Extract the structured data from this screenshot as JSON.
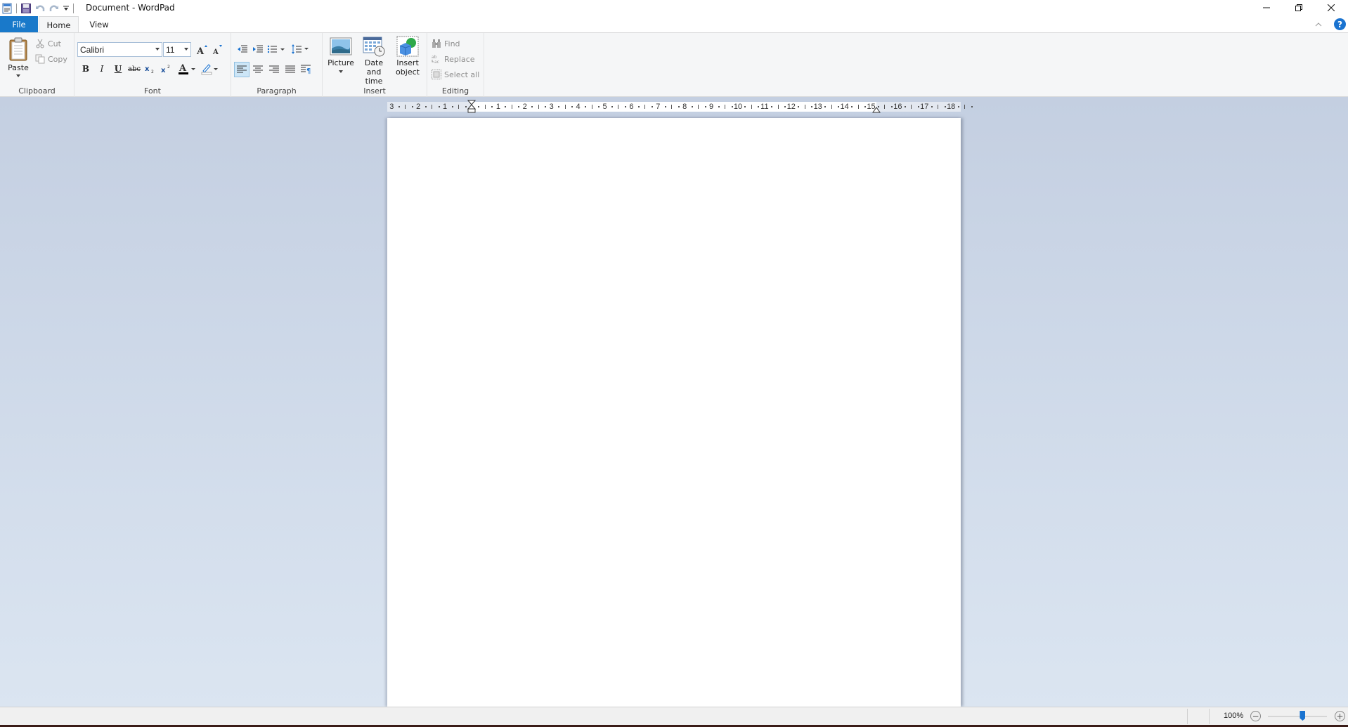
{
  "window": {
    "title": "Document - WordPad",
    "controls": {
      "minimize": "minimize-icon",
      "restore": "restore-icon",
      "close": "close-icon"
    }
  },
  "quick_access": [
    {
      "name": "app-icon"
    },
    {
      "name": "save-icon"
    },
    {
      "name": "undo-icon"
    },
    {
      "name": "redo-icon"
    },
    {
      "name": "customize-qat-icon"
    }
  ],
  "tabs": [
    {
      "label": "File",
      "active": false
    },
    {
      "label": "Home",
      "active": true
    },
    {
      "label": "View",
      "active": false
    }
  ],
  "help_label": "?",
  "ribbon": {
    "clipboard": {
      "label": "Clipboard",
      "paste": "Paste",
      "cut": "Cut",
      "copy": "Copy"
    },
    "font": {
      "label": "Font",
      "family": "Calibri",
      "size": "11",
      "bold": "B",
      "italic": "I",
      "underline": "U",
      "strikethrough": "abc",
      "font_color": "#000000",
      "highlight_color": "#ffffff"
    },
    "paragraph": {
      "label": "Paragraph",
      "alignment": "left"
    },
    "insert": {
      "label": "Insert",
      "picture": "Picture",
      "datetime": "Date and time",
      "datetime_line1": "Date and",
      "datetime_line2": "time",
      "object_line1": "Insert",
      "object_line2": "object"
    },
    "editing": {
      "label": "Editing",
      "find": "Find",
      "replace": "Replace",
      "select_all": "Select all"
    }
  },
  "ruler": {
    "left_labels": [
      "3",
      "2",
      "1"
    ],
    "right_labels": [
      "1",
      "2",
      "3",
      "4",
      "5",
      "6",
      "7",
      "8",
      "9",
      "10",
      "11",
      "12",
      "13",
      "14",
      "15",
      "16",
      "17",
      "18"
    ]
  },
  "document": {
    "content": ""
  },
  "status": {
    "zoom_level": "100%",
    "zoom_percent": 100
  },
  "colors": {
    "accent": "#1979ca",
    "ribbon_bg": "#f5f6f7",
    "workspace_top": "#c4cfe1",
    "workspace_bottom": "#dbe5f1"
  }
}
